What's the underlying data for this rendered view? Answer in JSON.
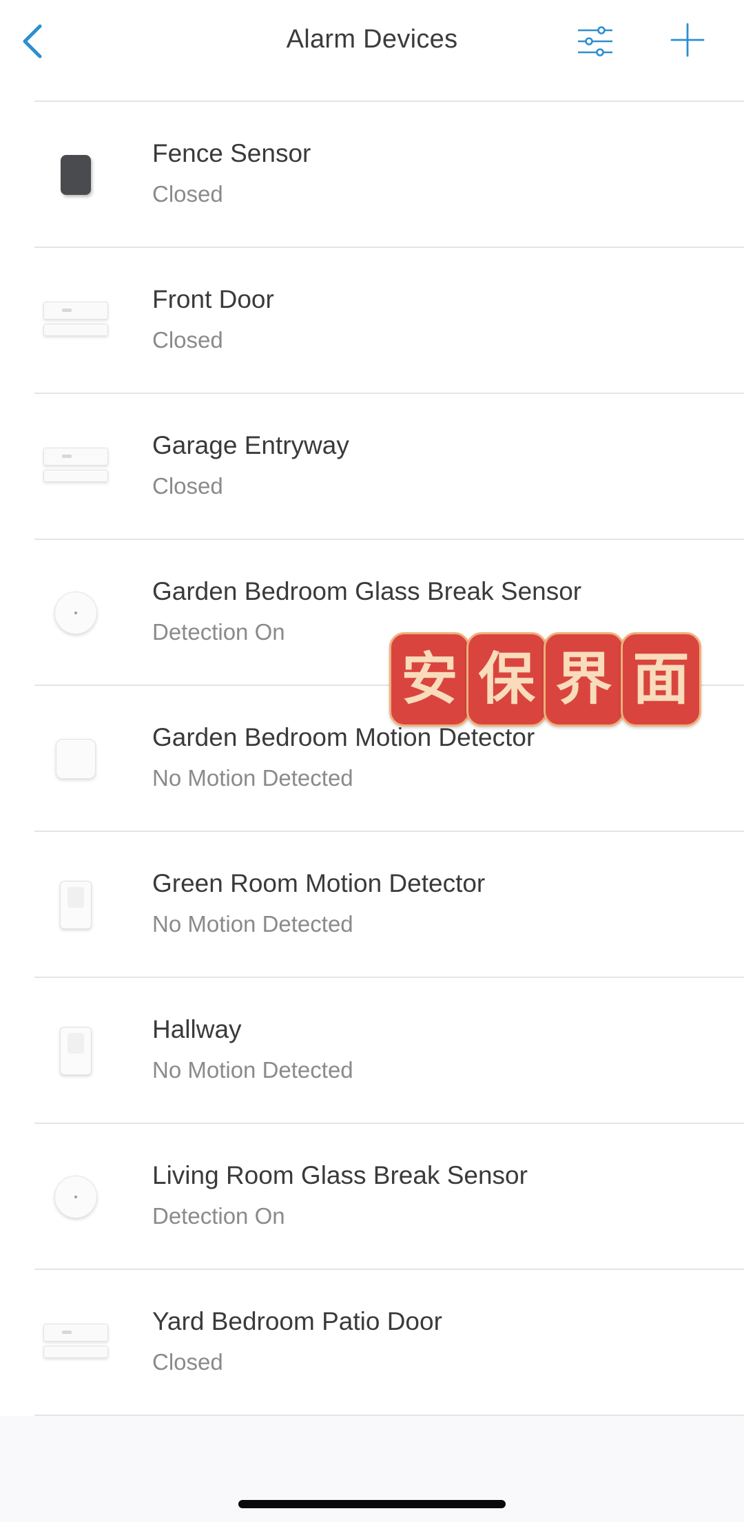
{
  "header": {
    "title": "Alarm Devices",
    "back_icon": "chevron-left-icon",
    "filter_icon": "sliders-icon",
    "add_icon": "plus-icon",
    "accent_color": "#2a8fd0"
  },
  "devices": [
    {
      "name": "Fence Sensor",
      "status": "Closed",
      "icon": "keypad"
    },
    {
      "name": "Front Door",
      "status": "Closed",
      "icon": "contact-sensor"
    },
    {
      "name": "Garage Entryway",
      "status": "Closed",
      "icon": "contact-sensor"
    },
    {
      "name": "Garden Bedroom Glass Break Sensor",
      "status": "Detection On",
      "icon": "glass-break-sensor"
    },
    {
      "name": "Garden Bedroom Motion Detector",
      "status": "No Motion Detected",
      "icon": "motion-detector"
    },
    {
      "name": "Green Room Motion Detector",
      "status": "No Motion Detected",
      "icon": "motion-detector"
    },
    {
      "name": "Hallway",
      "status": "No Motion Detected",
      "icon": "motion-detector"
    },
    {
      "name": "Living Room Glass Break Sensor",
      "status": "Detection On",
      "icon": "glass-break-sensor"
    },
    {
      "name": "Yard Bedroom Patio Door",
      "status": "Closed",
      "icon": "contact-sensor"
    }
  ],
  "watermark": {
    "chars": [
      "安",
      "保",
      "界",
      "面"
    ]
  }
}
